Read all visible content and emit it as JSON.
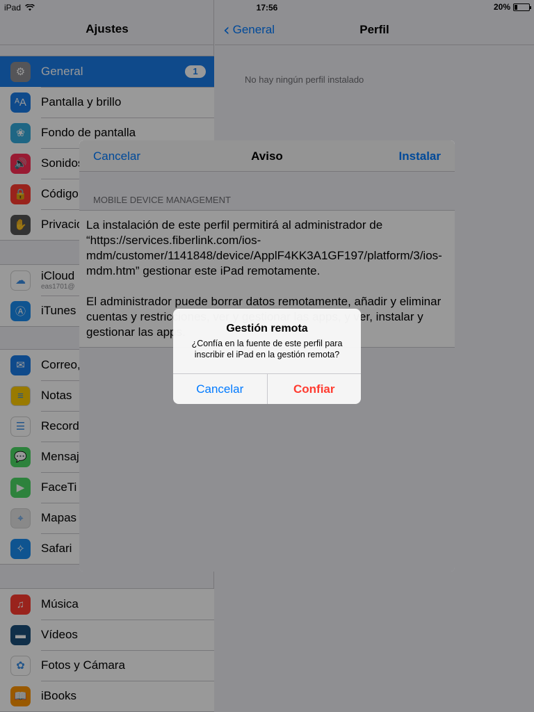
{
  "status_bar": {
    "device": "iPad",
    "time": "17:56",
    "battery": "20%",
    "battery_level": 0.2
  },
  "left_pane": {
    "title": "Ajustes",
    "groups": [
      {
        "rows": [
          {
            "label": "General",
            "icon": "gear-icon",
            "color": "#8e8e93",
            "badge": "1",
            "selected": true
          },
          {
            "label": "Pantalla y brillo",
            "icon": "text-size-icon",
            "color": "#1a7ce8"
          },
          {
            "label": "Fondo de pantalla",
            "icon": "flower-icon",
            "color": "#34aadc"
          },
          {
            "label": "Sonidos",
            "icon": "speaker-icon",
            "color": "#ff2d55"
          },
          {
            "label": "Código",
            "icon": "lock-icon",
            "color": "#ff3b30"
          },
          {
            "label": "Privacidad",
            "icon": "hand-icon",
            "color": "#555555"
          }
        ]
      },
      {
        "rows": [
          {
            "label": "iCloud",
            "sub": "eas1701@",
            "icon": "cloud-icon",
            "color": "#ffffff"
          },
          {
            "label": "iTunes",
            "icon": "app-store-icon",
            "color": "#1a8cf0"
          }
        ]
      },
      {
        "rows": [
          {
            "label": "Correo,",
            "icon": "mail-icon",
            "color": "#1a7ce8"
          },
          {
            "label": "Notas",
            "icon": "notes-icon",
            "color": "#ffcc00"
          },
          {
            "label": "Record",
            "icon": "reminders-icon",
            "color": "#ffffff"
          },
          {
            "label": "Mensaj",
            "icon": "messages-icon",
            "color": "#4cd964"
          },
          {
            "label": "FaceTi",
            "icon": "facetime-icon",
            "color": "#4cd964"
          },
          {
            "label": "Mapas",
            "icon": "maps-icon",
            "color": "#e5e5e5"
          },
          {
            "label": "Safari",
            "icon": "compass-icon",
            "color": "#1a8cf0"
          }
        ]
      },
      {
        "rows": [
          {
            "label": "Música",
            "icon": "music-icon",
            "color": "#ff3b30"
          },
          {
            "label": "Vídeos",
            "icon": "clapper-icon",
            "color": "#1c4f7a"
          },
          {
            "label": "Fotos y Cámara",
            "icon": "photos-icon",
            "color": "#ffffff"
          },
          {
            "label": "iBooks",
            "icon": "book-icon",
            "color": "#ff9500"
          }
        ]
      }
    ]
  },
  "right_pane": {
    "back_label": "General",
    "title": "Perfil",
    "empty_message": "No hay ningún perfil instalado"
  },
  "sheet": {
    "cancel": "Cancelar",
    "title": "Aviso",
    "install": "Instalar",
    "section_header": "MOBILE DEVICE MANAGEMENT",
    "paragraph1": "La instalación de este perfil permitirá al administrador de “https://services.fiberlink.com/ios-mdm/customer/1141848/device/ApplF4KK3A1GF197/platform/3/ios-mdm.htm” gestionar este iPad remotamente.",
    "paragraph2": "El administrador puede borrar datos remotamente, añadir y eliminar cuentas y restricciones, ver y gestionar las apps, y ver, instalar y gestionar las apps."
  },
  "alert": {
    "title": "Gestión remota",
    "message": "¿Confía en la fuente de este perfil para inscribir el iPad en la gestión remota?",
    "cancel": "Cancelar",
    "confirm": "Confiar"
  }
}
